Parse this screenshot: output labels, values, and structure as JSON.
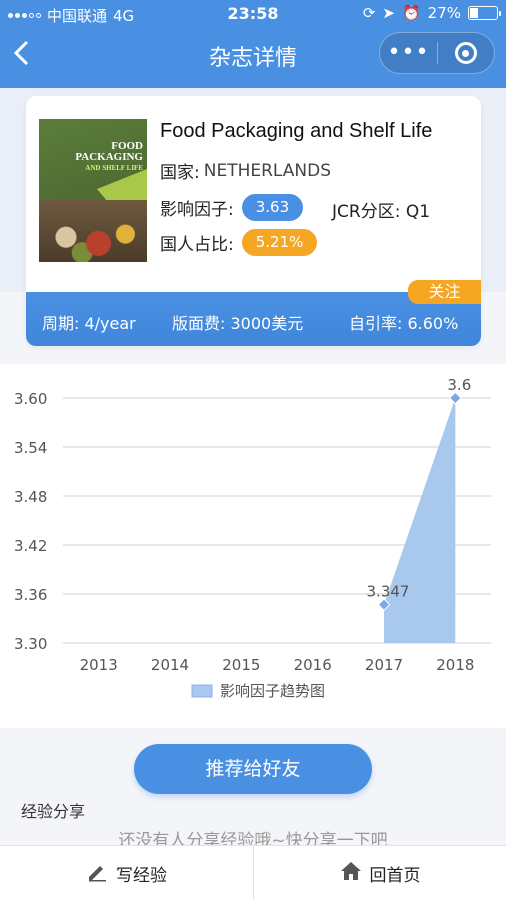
{
  "status_bar": {
    "carrier": "中国联通",
    "network": "4G",
    "time": "23:58",
    "battery": "27%"
  },
  "nav": {
    "title": "杂志详情",
    "more_icon": "more-dots-icon",
    "close_icon": "target-icon"
  },
  "journal": {
    "cover_title_line1": "FOOD",
    "cover_title_line2": "PACKAGING",
    "cover_subtitle": "AND SHELF LIFE",
    "title": "Food Packaging and Shelf Life",
    "country_label": "国家:",
    "country": "NETHERLANDS",
    "impact_label": "影响因子:",
    "impact_factor": "3.63",
    "jcr_label": "JCR分区:",
    "jcr_value": "Q1",
    "domestic_label": "国人占比:",
    "domestic_ratio": "5.21%",
    "follow_label": "关注"
  },
  "info_bar": {
    "cycle": "周期: 4/year",
    "fee": "版面费: 3000美元",
    "self_cite": "自引率: 6.60%"
  },
  "chart_data": {
    "type": "area",
    "categories": [
      "2013",
      "2014",
      "2015",
      "2016",
      "2017",
      "2018"
    ],
    "series": [
      {
        "name": "影响因子趋势图",
        "values": [
          null,
          null,
          null,
          null,
          3.347,
          3.6
        ]
      }
    ],
    "ylim": [
      3.3,
      3.6
    ],
    "yticks": [
      "3.30",
      "3.36",
      "3.42",
      "3.48",
      "3.54",
      "3.60"
    ],
    "point_labels": [
      "3.347",
      "3.6"
    ],
    "legend": "bottom",
    "grid": true,
    "color": "#a9c8ee"
  },
  "actions": {
    "recommend": "推荐给好友"
  },
  "experience": {
    "title": "经验分享",
    "empty_text": "还没有人分享经验哦~快分享一下吧"
  },
  "tabbar": {
    "write": "写经验",
    "home": "回首页"
  }
}
